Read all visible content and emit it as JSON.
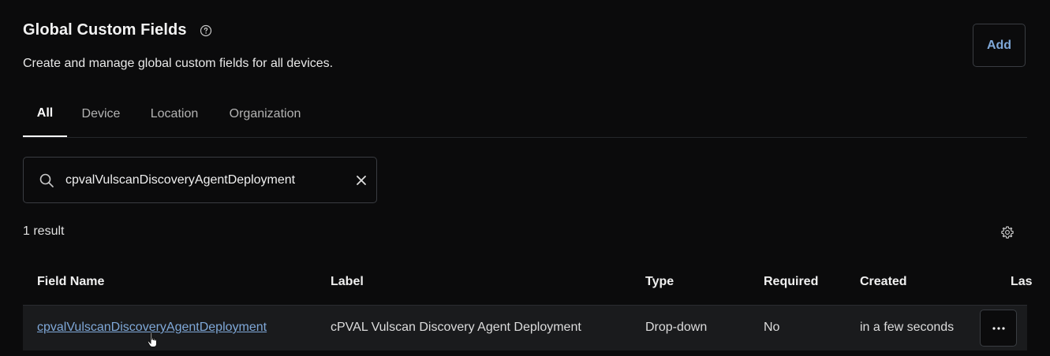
{
  "header": {
    "title": "Global Custom Fields",
    "subtitle": "Create and manage global custom fields for all devices.",
    "help_icon": "question-circle-icon",
    "add_label": "Add",
    "accent_color": "#7fa8d8"
  },
  "tabs": [
    {
      "label": "All",
      "active": true
    },
    {
      "label": "Device",
      "active": false
    },
    {
      "label": "Location",
      "active": false
    },
    {
      "label": "Organization",
      "active": false
    }
  ],
  "search": {
    "value": "cpvalVulscanDiscoveryAgentDeployment",
    "search_icon": "search-icon",
    "clear_icon": "close-icon"
  },
  "results": {
    "count_label": "1 result",
    "settings_icon": "gear-icon"
  },
  "table": {
    "columns": [
      "Field Name",
      "Label",
      "Type",
      "Required",
      "Created",
      "Las"
    ],
    "rows": [
      {
        "field_name": "cpvalVulscanDiscoveryAgentDeployment",
        "label": "cPVAL Vulscan Discovery Agent Deployment",
        "type": "Drop-down",
        "required": "No",
        "created": "in a few seconds",
        "actions_icon": "more-horizontal-icon"
      }
    ]
  }
}
